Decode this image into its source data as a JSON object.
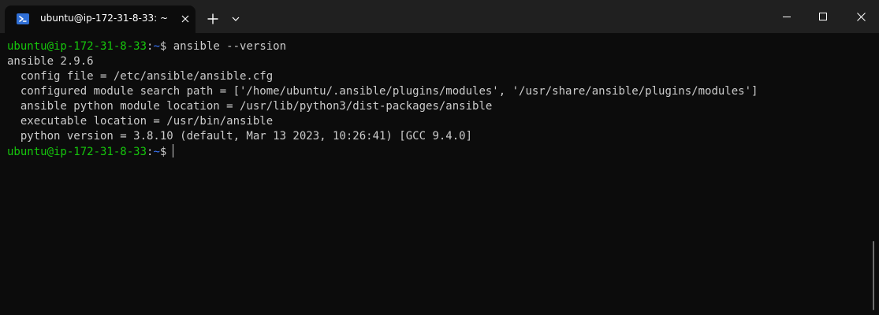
{
  "tab": {
    "title": "ubuntu@ip-172-31-8-33: ~",
    "icon": "linux-shell-icon",
    "close_icon": "close-icon"
  },
  "titlebar": {
    "new_tab_icon": "plus-icon",
    "dropdown_icon": "chevron-down-icon",
    "minimize_icon": "minimize-icon",
    "maximize_icon": "maximize-icon",
    "close_icon": "close-icon"
  },
  "colors": {
    "background": "#0c0c0c",
    "text": "#cccccc",
    "prompt_user": "#16c60c",
    "prompt_path": "#3b78ff"
  },
  "terminal": {
    "prompt1": {
      "user": "ubuntu@ip-172-31-8-33",
      "sep": ":",
      "path": "~",
      "symbol": "$ ",
      "command": "ansible --version"
    },
    "output": [
      "ansible 2.9.6",
      "  config file = /etc/ansible/ansible.cfg",
      "  configured module search path = ['/home/ubuntu/.ansible/plugins/modules', '/usr/share/ansible/plugins/modules']",
      "  ansible python module location = /usr/lib/python3/dist-packages/ansible",
      "  executable location = /usr/bin/ansible",
      "  python version = 3.8.10 (default, Mar 13 2023, 10:26:41) [GCC 9.4.0]"
    ],
    "prompt2": {
      "user": "ubuntu@ip-172-31-8-33",
      "sep": ":",
      "path": "~",
      "symbol": "$"
    }
  }
}
